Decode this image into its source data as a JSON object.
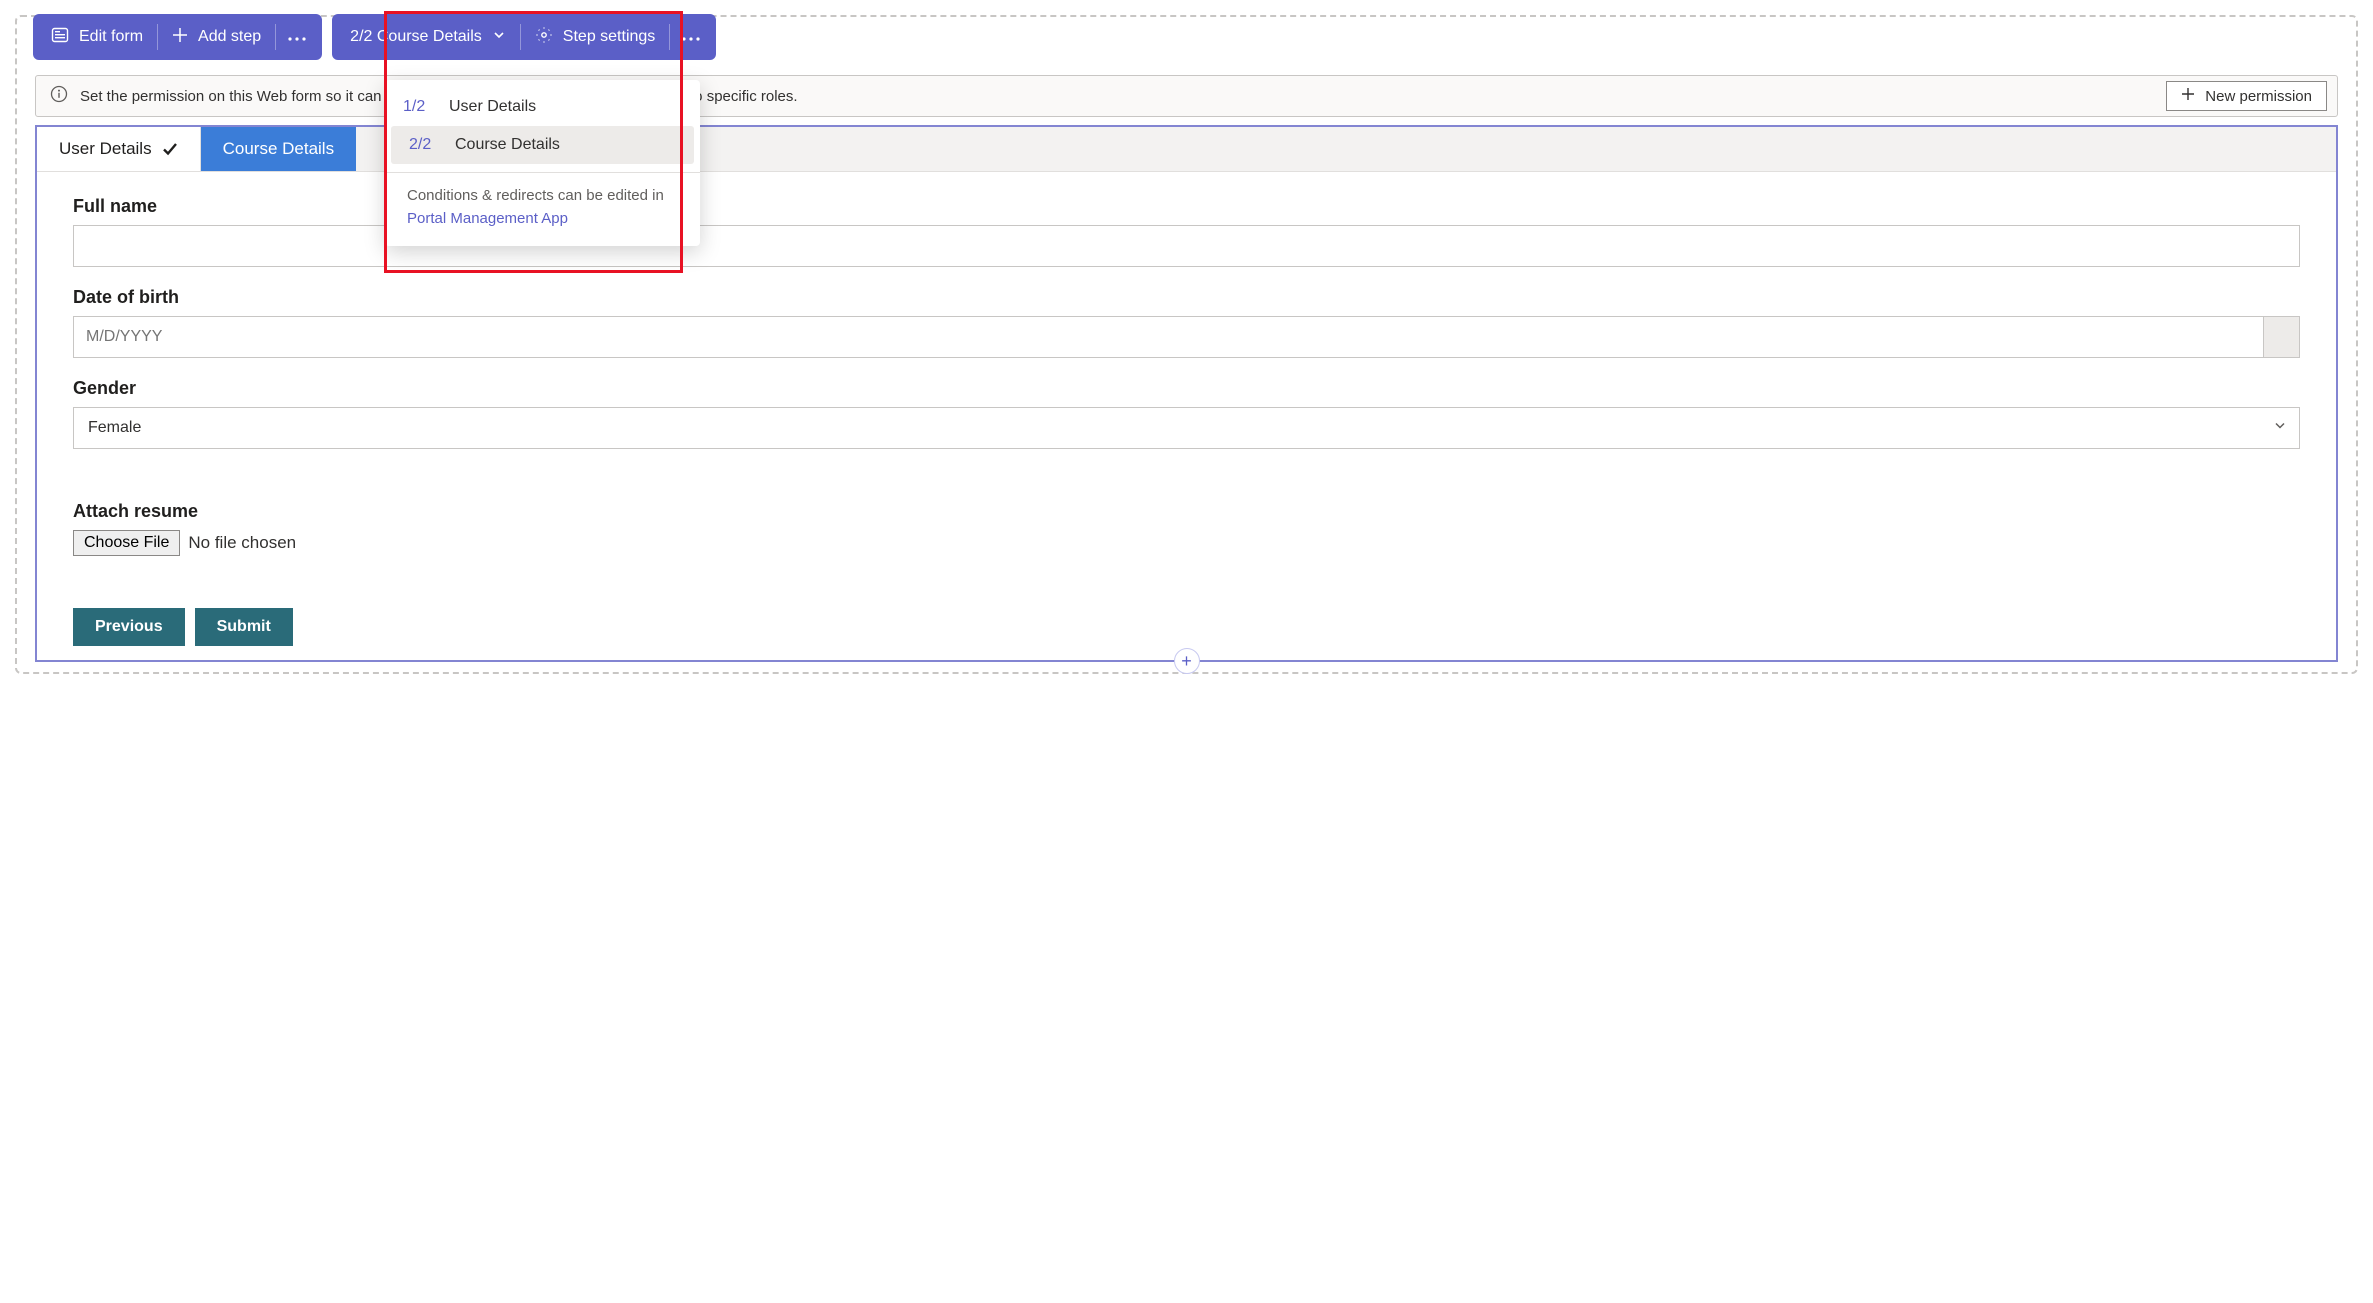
{
  "toolbar_left": {
    "edit_form": "Edit form",
    "add_step": "Add step"
  },
  "toolbar_right": {
    "step_selector": "2/2 Course Details",
    "step_settings": "Step settings"
  },
  "dropdown": {
    "items": [
      {
        "num": "1/2",
        "label": "User Details"
      },
      {
        "num": "2/2",
        "label": "Course Details"
      }
    ],
    "footer_text": "Conditions & redirects can be edited in",
    "footer_link": "Portal Management App"
  },
  "info_bar": {
    "text": "Set the permission on this Web form so it can be viewed by everyone or limit the interaction to specific roles.",
    "button": "New permission"
  },
  "tabs": [
    {
      "label": "User Details",
      "completed": true
    },
    {
      "label": "Course Details",
      "completed": false
    }
  ],
  "form": {
    "full_name_label": "Full name",
    "full_name_value": "",
    "dob_label": "Date of birth",
    "dob_placeholder": "M/D/YYYY",
    "gender_label": "Gender",
    "gender_value": "Female",
    "attach_label": "Attach resume",
    "choose_file": "Choose File",
    "no_file": "No file chosen"
  },
  "nav": {
    "previous": "Previous",
    "submit": "Submit"
  }
}
